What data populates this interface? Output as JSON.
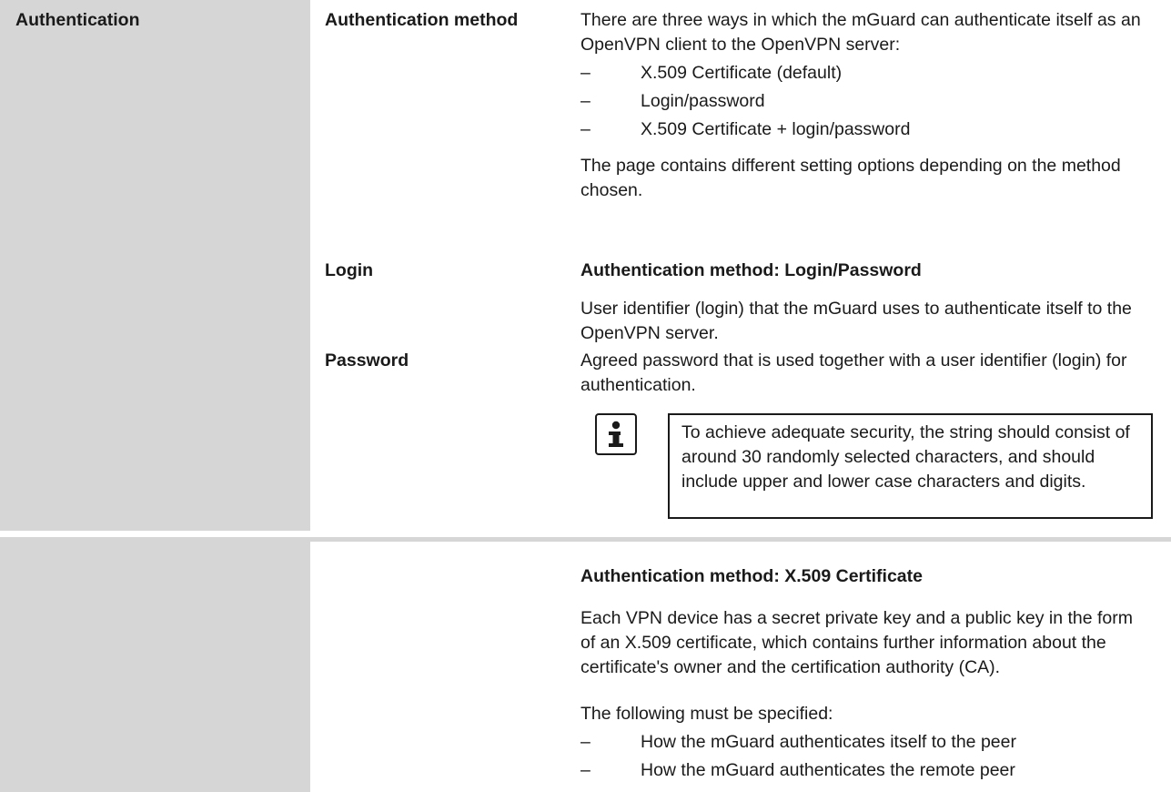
{
  "section": {
    "label": "Authentication"
  },
  "method": {
    "label": "Authentication method",
    "intro": "There are three ways in which the mGuard can authenticate itself as an OpenVPN client to the OpenVPN server:",
    "dash": "–",
    "options": [
      "X.509 Certificate (default)",
      "Login/password",
      "X.509 Certificate + login/password"
    ],
    "note": "The page contains different setting options depending on the method chosen."
  },
  "login": {
    "label": "Login",
    "heading": "Authentication method: Login/Password",
    "desc": "User identifier (login) that the mGuard uses to authenticate itself to the OpenVPN server."
  },
  "password": {
    "label": "Password",
    "desc": "Agreed password that is used together with a user identifier (login) for authentication.",
    "info_icon": "info-icon",
    "info_text": "To achieve adequate security, the string should consist of around 30 randomly selected characters, and should include upper and lower case characters and digits."
  },
  "x509": {
    "heading": "Authentication method: X.509 Certificate",
    "desc": "Each VPN device has a secret private key and a public key in the form of an X.509 certificate, which contains further information about the certificate's owner and the certification authority (CA).",
    "spec_intro": "The following must be specified:",
    "items": [
      "How the mGuard authenticates itself to the peer",
      "How the mGuard authenticates the remote peer"
    ]
  }
}
